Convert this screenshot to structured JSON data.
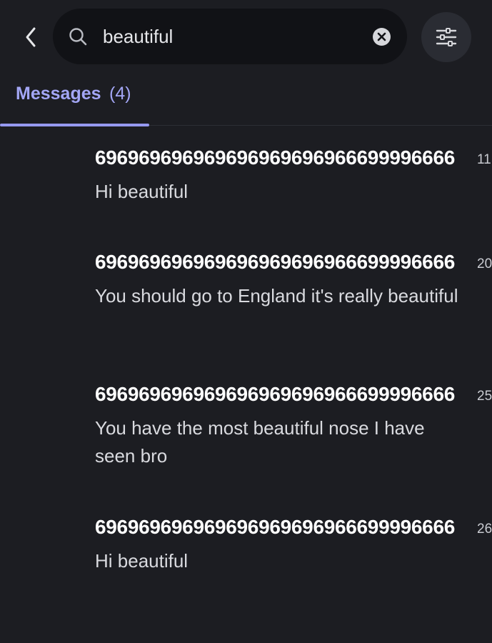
{
  "search": {
    "value": "beautiful",
    "placeholder": "Search"
  },
  "tabs": [
    {
      "label": "Messages",
      "count": "(4)",
      "active": true
    }
  ],
  "results": [
    {
      "author": "696969696969696969696966699996666",
      "time": "11",
      "text": "Hi beautiful"
    },
    {
      "author": "696969696969696969696966699996666",
      "time": "20",
      "text": "You should go to England it's really beautiful"
    },
    {
      "author": "696969696969696969696966699996666",
      "time": "25",
      "text": "You have the most beautiful nose I have seen bro"
    },
    {
      "author": "696969696969696969696966699996666",
      "time": "26",
      "text": "Hi beautiful"
    }
  ],
  "colors": {
    "background": "#1c1d22",
    "search_bg": "#111216",
    "accent": "#a3a6f5",
    "filter_btn_bg": "#2a2c33"
  },
  "icons": {
    "back": "chevron-left-icon",
    "search": "search-icon",
    "clear": "clear-x-circle-icon",
    "filter": "sliders-filter-icon"
  }
}
